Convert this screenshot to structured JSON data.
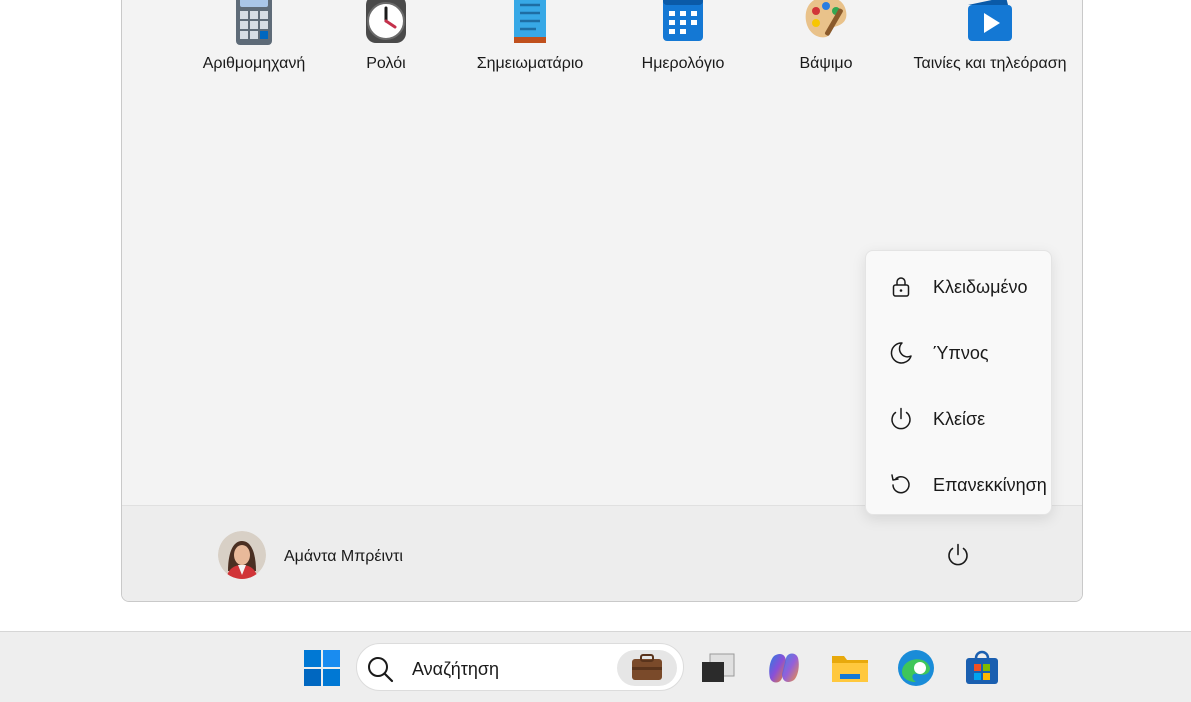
{
  "pinned_apps": [
    {
      "label": "Αριθμομηχανή",
      "icon": "calculator-icon"
    },
    {
      "label": "Ρολόι",
      "icon": "clock-icon"
    },
    {
      "label": "Σημειωματάριο",
      "icon": "notepad-icon"
    },
    {
      "label": "Ημερολόγιο",
      "icon": "calendar-icon"
    },
    {
      "label": "Βάψιμο",
      "icon": "paint-icon"
    },
    {
      "label": "Ταινίες και τηλεόραση",
      "icon": "movies-tv-icon"
    }
  ],
  "power_menu": {
    "items": [
      {
        "label": "Κλειδωμένο",
        "icon": "lock-icon"
      },
      {
        "label": "Ύπνος",
        "icon": "moon-icon"
      },
      {
        "label": "Κλείσε",
        "icon": "power-icon"
      },
      {
        "label": "Επανεκκίνηση",
        "icon": "restart-icon"
      }
    ]
  },
  "user": {
    "name": "Αμάντα Μπρέιντι"
  },
  "taskbar": {
    "search_placeholder": "Αναζήτηση",
    "items": [
      "windows-start-icon",
      "search-icon",
      "briefcase-icon",
      "task-view-icon",
      "copilot-icon",
      "file-explorer-icon",
      "edge-icon",
      "store-icon"
    ]
  },
  "colors": {
    "accent": "#0067c0",
    "panel_bg": "#f3f3f3",
    "taskbar_bg": "#eeeeee"
  }
}
